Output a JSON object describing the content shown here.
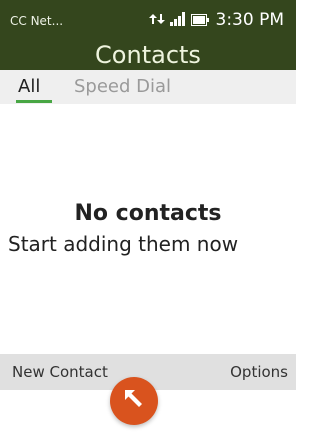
{
  "status": {
    "carrier": "CC Net...",
    "time": "3:30 PM",
    "icons": [
      "data-arrows-icon",
      "signal-icon",
      "battery-icon"
    ]
  },
  "app": {
    "title": "Contacts"
  },
  "tabs": [
    {
      "label": "All",
      "active": true
    },
    {
      "label": "Speed Dial",
      "active": false
    }
  ],
  "empty_state": {
    "title": "No contacts",
    "subtitle": "Start adding them now"
  },
  "softkeys": {
    "left": "New Contact",
    "right": "Options"
  },
  "pointer": {
    "icon": "arrow-cursor-icon"
  },
  "colors": {
    "header": "#34461d",
    "tab_indicator": "#48a644",
    "pointer": "#d9531e"
  }
}
